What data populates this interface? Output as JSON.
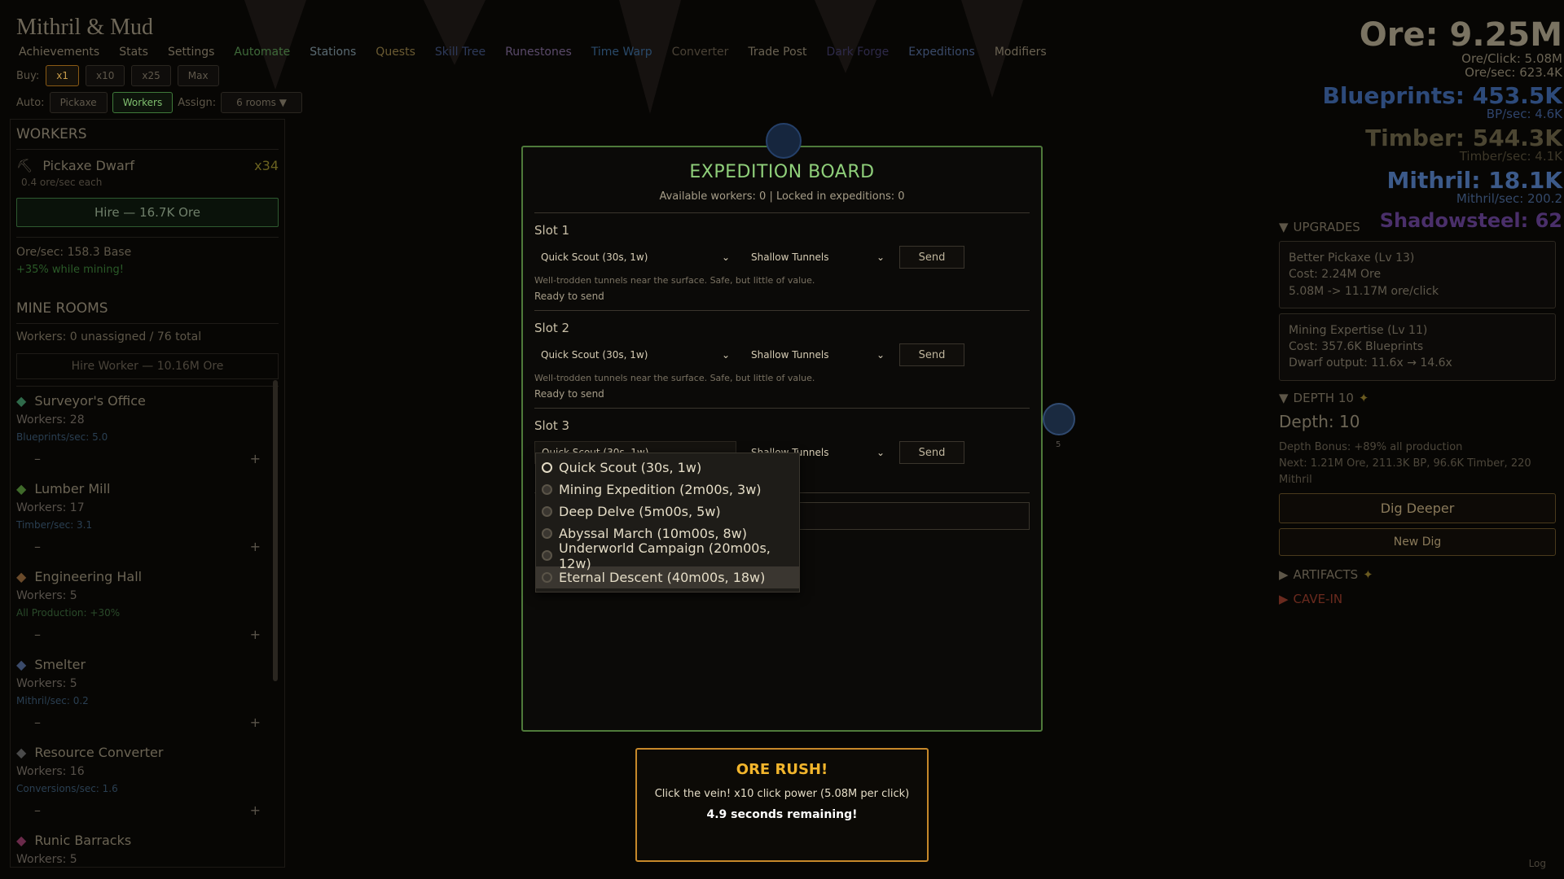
{
  "header": {
    "title": "Mithril & Mud",
    "nav": [
      "Achievements",
      "Stats",
      "Settings",
      "Automate",
      "Stations",
      "Quests",
      "Skill Tree",
      "Runestones",
      "Time Warp",
      "Converter",
      "Trade Post",
      "Dark Forge",
      "Expeditions",
      "Modifiers"
    ],
    "nav_colors": [
      "#6a6252",
      "#6a6252",
      "#6a6252",
      "#3f6a3a",
      "#5a6a72",
      "#6a5a32",
      "#2e3a5a",
      "#5a4a6a",
      "#2a4a6a",
      "#4a4236",
      "#6a6252",
      "#2e2a4a",
      "#3a4a6a",
      "#6a6252"
    ],
    "buy_label": "Buy:",
    "buy_options": [
      "x1",
      "x10",
      "x25",
      "Max"
    ],
    "auto_label": "Auto:",
    "auto_options": [
      "Pickaxe",
      "Workers"
    ],
    "assign_label": "Assign:",
    "assign_value": "6 rooms ▼"
  },
  "stats": {
    "ore": "Ore: 9.25M",
    "ore_click": "Ore/Click: 5.08M",
    "ore_sec": "Ore/sec: 623.4K",
    "blueprints": "Blueprints: 453.5K",
    "bp_sec": "BP/sec: 4.6K",
    "timber": "Timber: 544.3K",
    "timber_sec": "Timber/sec: 4.1K",
    "mithril": "Mithril: 18.1K",
    "mithril_sec": "Mithril/sec: 200.2",
    "shadowsteel": "Shadowsteel: 62"
  },
  "right_panel": {
    "upgrades_title": "UPGRADES",
    "upgrades": [
      {
        "name": "Better Pickaxe (Lv 13)",
        "cost": "Cost: 2.24M Ore",
        "effect": "5.08M -> 11.17M ore/click"
      },
      {
        "name": "Mining Expertise (Lv 11)",
        "cost": "Cost: 357.6K Blueprints",
        "effect": "Dwarf output: 11.6x → 14.6x"
      }
    ],
    "depth_title": "DEPTH 10",
    "depth_value": "Depth: 10",
    "depth_bonus": "Depth Bonus: +89% all production",
    "depth_next": "Next: 1.21M Ore, 211.3K BP, 96.6K Timber, 220 Mithril",
    "dig_deeper": "Dig Deeper",
    "new_dig": "New Dig",
    "artifacts_title": "ARTIFACTS",
    "cavein_title": "CAVE-IN"
  },
  "left_panel": {
    "workers_title": "WORKERS",
    "worker_name": "Pickaxe Dwarf",
    "worker_count": "x34",
    "worker_rate": "0.4 ore/sec each",
    "hire_label": "Hire — 16.7K Ore",
    "ore_sec_base": "Ore/sec: 158.3 Base",
    "mining_bonus": "+35% while mining!",
    "mine_rooms_title": "MINE ROOMS",
    "workers_summary": "Workers: 0 unassigned / 76 total",
    "hire_worker": "Hire Worker — 10.16M Ore",
    "rooms": [
      {
        "name": "Surveyor's Office",
        "workers": "Workers: 28",
        "stat": "Blueprints/sec: 5.0",
        "color": "#2a3f52",
        "icon": "#2f6a4a"
      },
      {
        "name": "Lumber Mill",
        "workers": "Workers: 17",
        "stat": "Timber/sec: 3.1",
        "color": "#2a3f52",
        "icon": "#3f6a2a"
      },
      {
        "name": "Engineering Hall",
        "workers": "Workers: 5",
        "stat": "All Production: +30%",
        "color": "#2a4a2a",
        "icon": "#6a4a2a"
      },
      {
        "name": "Smelter",
        "workers": "Workers: 5",
        "stat": "Mithril/sec: 0.2",
        "color": "#2a3f52",
        "icon": "#3a4a6a"
      },
      {
        "name": "Resource Converter",
        "workers": "Workers: 16",
        "stat": "Conversions/sec: 1.6",
        "color": "#2a3f52",
        "icon": "#4a4a4a"
      },
      {
        "name": "Runic Barracks",
        "workers": "Workers: 5",
        "stat": "",
        "color": "#2a3f52",
        "icon": "#6a2a4a"
      }
    ],
    "minus": "–",
    "plus": "+"
  },
  "modal": {
    "title": "EXPEDITION BOARD",
    "subtitle": "Available workers: 0  |  Locked in expeditions: 0",
    "slots": [
      {
        "label": "Slot 1",
        "mission": "Quick Scout (30s, 1w)",
        "location": "Shallow Tunnels",
        "send": "Send",
        "desc": "Well-trodden tunnels near the surface. Safe, but little of value.",
        "status": "Ready to send"
      },
      {
        "label": "Slot 2",
        "mission": "Quick Scout (30s, 1w)",
        "location": "Shallow Tunnels",
        "send": "Send",
        "desc": "Well-trodden tunnels near the surface. Safe, but little of value.",
        "status": "Ready to send"
      },
      {
        "label": "Slot 3",
        "mission": "Quick Scout (30s, 1w)",
        "location": "Shallow Tunnels",
        "send": "Send",
        "desc": "",
        "status": ""
      }
    ]
  },
  "dropdown": {
    "options": [
      "Quick Scout (30s, 1w)",
      "Mining Expedition (2m00s, 3w)",
      "Deep Delve (5m00s, 5w)",
      "Abyssal March (10m00s, 8w)",
      "Underworld Campaign (20m00s, 12w)",
      "Eternal Descent (40m00s, 18w)"
    ],
    "selected_index": 0,
    "highlighted_index": 5
  },
  "ore_rush": {
    "title": "ORE RUSH!",
    "desc": "Click the vein! x10 click power (5.08M per click)",
    "remaining": "4.9 seconds remaining!"
  },
  "misc": {
    "orb_label": "5",
    "log_label": "Log"
  }
}
